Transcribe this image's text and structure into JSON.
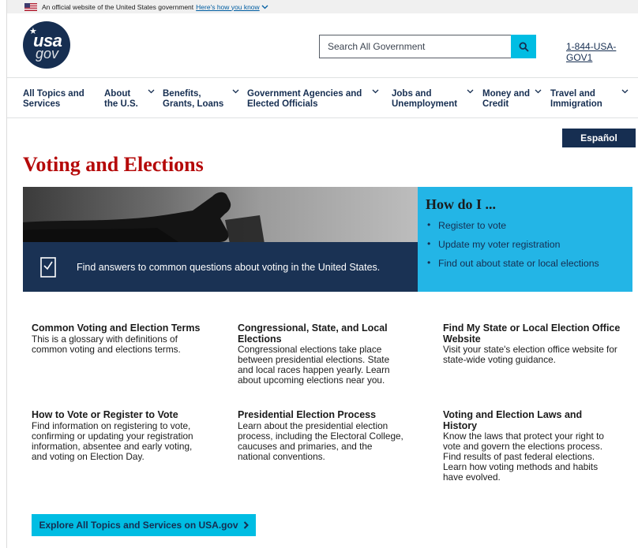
{
  "banner": {
    "text": "An official website of the United States government",
    "link": "Here's how you know"
  },
  "header": {
    "logo_top": "usa",
    "logo_bottom": "gov",
    "search_placeholder": "Search All Government",
    "phone": "1-844-USA-GOV1"
  },
  "nav": {
    "items": [
      {
        "label": "All Topics and Services"
      },
      {
        "label": "About the U.S."
      },
      {
        "label": "Benefits, Grants, Loans"
      },
      {
        "label": "Government Agencies and Elected Officials"
      },
      {
        "label": "Jobs and Unemployment"
      },
      {
        "label": "Money and Credit"
      },
      {
        "label": "Travel and Immigration"
      }
    ]
  },
  "espanol_label": "Español",
  "page_title": "Voting and Elections",
  "hero": {
    "caption": "Find answers to common questions about voting in the United States."
  },
  "howdo": {
    "title": "How do I ...",
    "links": [
      "Register to vote",
      "Update my voter registration",
      "Find out about state or local elections"
    ]
  },
  "topics": [
    {
      "title": "Common Voting and Election Terms",
      "desc": "This is a glossary with definitions of common voting and elections terms."
    },
    {
      "title": "Congressional, State, and Local Elections",
      "desc": "Congressional elections take place between presidential elections. State and local races happen yearly. Learn about upcoming elections near you."
    },
    {
      "title": "Find My State or Local Election Office Website",
      "desc": "Visit your state's election office website for state-wide voting guidance."
    },
    {
      "title": "How to Vote or Register to Vote",
      "desc": "Find information on registering to vote, confirming or updating your registration information, absentee and early voting, and voting on Election Day."
    },
    {
      "title": "Presidential Election Process",
      "desc": "Learn about the presidential election process, including the Electoral College, caucuses and primaries, and the national conventions."
    },
    {
      "title": "Voting and Election Laws and History",
      "desc": "Know the laws that protect your right to vote and govern the elections process. Find results of past federal elections. Learn how voting methods and habits have evolved."
    }
  ],
  "explore_label": "Explore All Topics and Services on USA.gov",
  "colors": {
    "navy": "#162e51",
    "title_red": "#b50909",
    "cyan": "#00bde3",
    "howdo_bg": "#23b5e6"
  }
}
